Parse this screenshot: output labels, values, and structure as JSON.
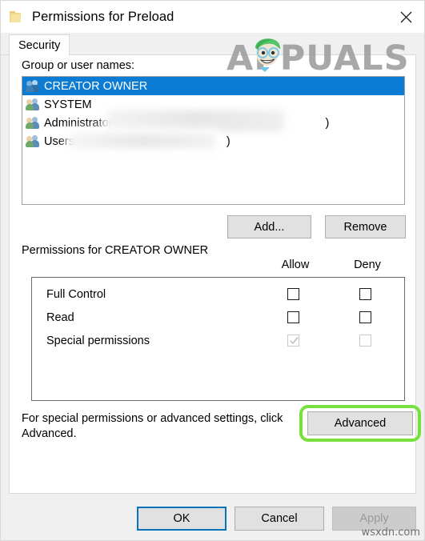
{
  "window": {
    "title": "Permissions for Preload",
    "folder_icon": "folder-icon",
    "close_icon": "close-icon"
  },
  "tabs": [
    {
      "label": "Security",
      "active": true
    }
  ],
  "groups_section": {
    "label": "Group or user names:",
    "items": [
      {
        "name": "CREATOR OWNER",
        "selected": true,
        "redacted": false
      },
      {
        "name": "SYSTEM",
        "selected": false,
        "redacted": false
      },
      {
        "name": "Administrators (",
        "suffix": ")",
        "selected": false,
        "redacted": true
      },
      {
        "name": "Users ",
        "suffix": ")",
        "selected": false,
        "redacted": true
      }
    ],
    "add_label": "Add...",
    "remove_label": "Remove"
  },
  "permissions_section": {
    "heading": "Permissions for CREATOR OWNER",
    "columns": [
      "Allow",
      "Deny"
    ],
    "rows": [
      {
        "name": "Full Control",
        "allow": "unchecked",
        "deny": "unchecked"
      },
      {
        "name": "Read",
        "allow": "unchecked",
        "deny": "unchecked"
      },
      {
        "name": "Special permissions",
        "allow": "checked-disabled",
        "deny": "unchecked-disabled"
      }
    ]
  },
  "advanced_section": {
    "hint": "For special permissions or advanced settings, click Advanced.",
    "button_label": "Advanced",
    "highlight_color": "#77e03c"
  },
  "footer": {
    "ok_label": "OK",
    "cancel_label": "Cancel",
    "apply_label": "Apply",
    "apply_disabled": true
  },
  "watermarks": {
    "brand": "APPUALS",
    "site": "wsxdn.com"
  },
  "colors": {
    "selection_blue": "#0c7bd4",
    "focus_blue": "#0a72bd",
    "button_face": "#e1e1e1",
    "dialog_face": "#f0f0f0",
    "folder_gold": "#f2d98a",
    "highlight_green": "#77e03c"
  }
}
